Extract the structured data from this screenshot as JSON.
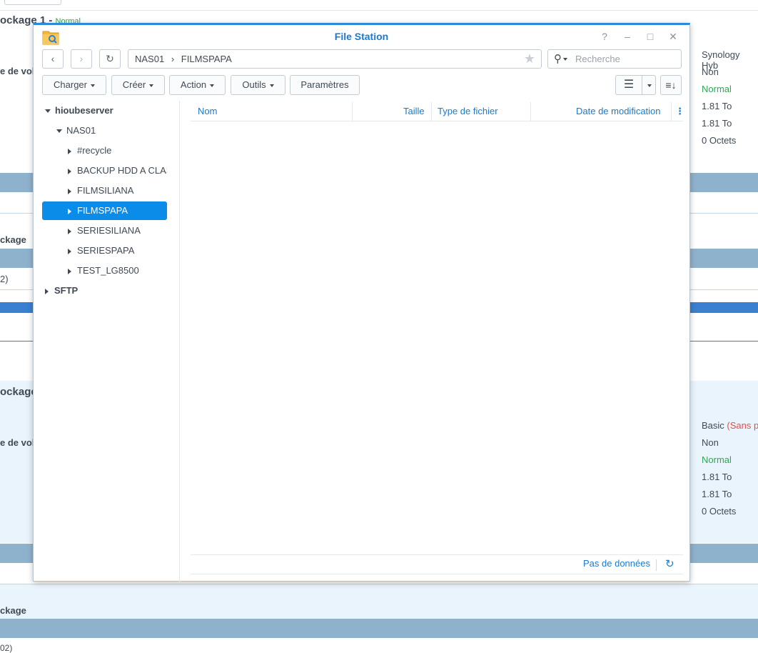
{
  "background": {
    "section1": {
      "title": "ockage 1 - ",
      "status": "Normal",
      "label_type": "e de vol",
      "values": [
        "Synology Hyb",
        "Non",
        "Normal",
        "1.81 To",
        "1.81 To",
        "0 Octets"
      ]
    },
    "row_label_a": "ckage",
    "row_text_a": "2)",
    "section2": {
      "title": "ockage",
      "label_type": "e de vol",
      "value_basic": "Basic ",
      "value_basic_note": "(Sans p",
      "values": [
        "Non",
        "Normal",
        "1.81 To",
        "1.81 To",
        "0 Octets"
      ]
    },
    "row_label_b": "ckage",
    "row_text_b": "02)"
  },
  "window": {
    "title": "File Station",
    "controls": {
      "help": "?",
      "minimize": "–",
      "maximize": "□",
      "close": "✕"
    },
    "path": {
      "root": "NAS01",
      "separator": "›",
      "current": "FILMSPAPA"
    },
    "search_placeholder": "Recherche",
    "toolbar": {
      "upload": "Charger",
      "create": "Créer",
      "action": "Action",
      "tools": "Outils",
      "settings": "Paramètres"
    },
    "tree": {
      "server": "hioubeserver",
      "share": "NAS01",
      "folders": [
        "#recycle",
        "BACKUP HDD A CLASSER",
        "FILMSILIANA",
        "FILMSPAPA",
        "SERIESILIANA",
        "SERIESPAPA",
        "TEST_LG8500"
      ],
      "selected": "FILMSPAPA",
      "other": "SFTP"
    },
    "columns": {
      "name": "Nom",
      "size": "Taille",
      "type": "Type de fichier",
      "modified": "Date de modification"
    },
    "footer": {
      "status": "Pas de données"
    }
  },
  "colors": {
    "accent": "#1a7ad0",
    "selection": "#0c8ce9",
    "status_ok": "#2fa84f",
    "titlebar_border": "#2d8ad8"
  }
}
